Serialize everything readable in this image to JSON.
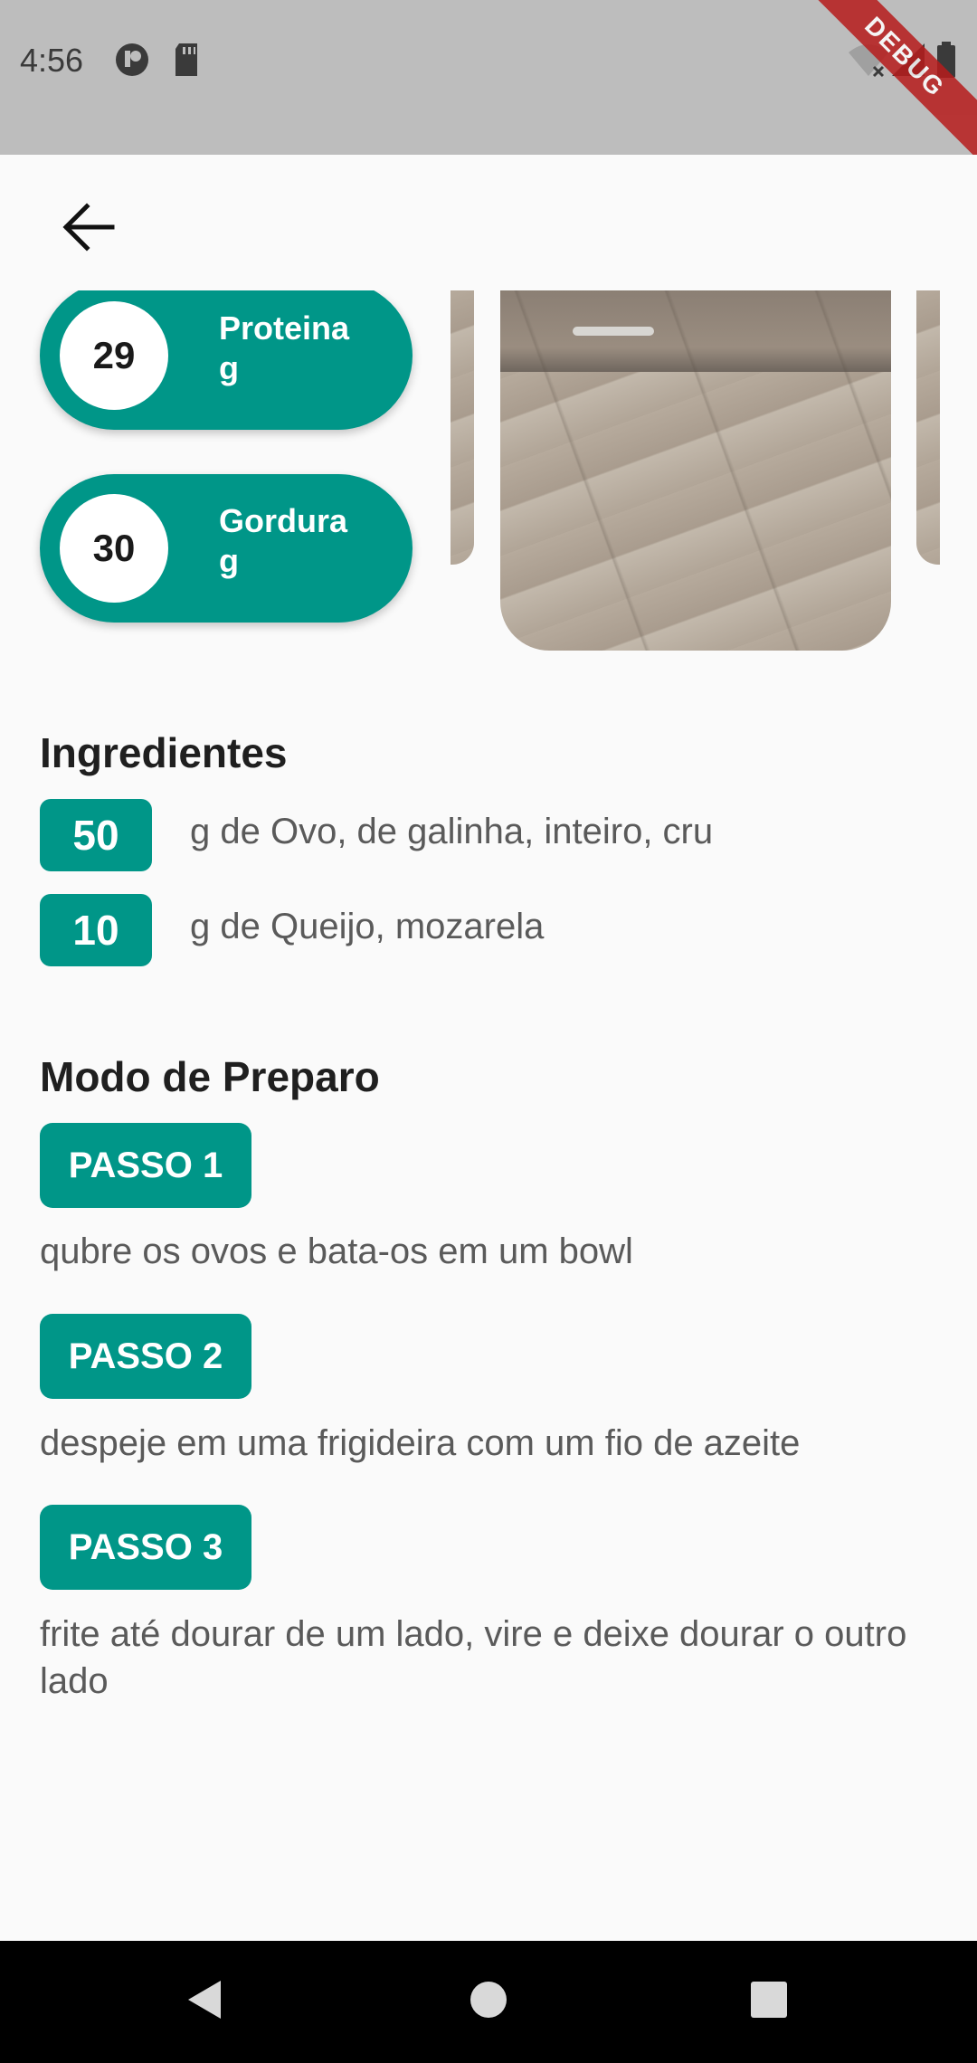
{
  "status_bar": {
    "time": "4:56",
    "debug_banner": "DEBUG",
    "icons": [
      "notification-icon",
      "sd-card-icon",
      "wifi-icon",
      "signal-icon",
      "battery-icon"
    ]
  },
  "app_bar": {
    "back_icon": "arrow-left-icon"
  },
  "nutrients": [
    {
      "value": "29",
      "label": "Proteina",
      "unit": "g"
    },
    {
      "value": "30",
      "label": "Gordura",
      "unit": "g"
    }
  ],
  "ingredients": {
    "title": "Ingredientes",
    "items": [
      {
        "qty": "50",
        "text": "g de Ovo, de galinha, inteiro, cru"
      },
      {
        "qty": "10",
        "text": "g de Queijo, mozarela"
      }
    ]
  },
  "preparation": {
    "title": "Modo de Preparo",
    "steps": [
      {
        "label": "PASSO 1",
        "text": "qubre os ovos e bata-os em um bowl"
      },
      {
        "label": "PASSO 2",
        "text": "despeje em uma frigideira com um fio de azeite"
      },
      {
        "label": "PASSO 3",
        "text": "frite até dourar de um lado, vire e deixe dourar o outro lado"
      }
    ]
  },
  "colors": {
    "accent": "#009688",
    "status_bar": "#bdbdbd",
    "background": "#fafafa"
  },
  "nav_bar": {
    "icons": [
      "back-triangle-icon",
      "home-circle-icon",
      "recents-square-icon"
    ]
  }
}
